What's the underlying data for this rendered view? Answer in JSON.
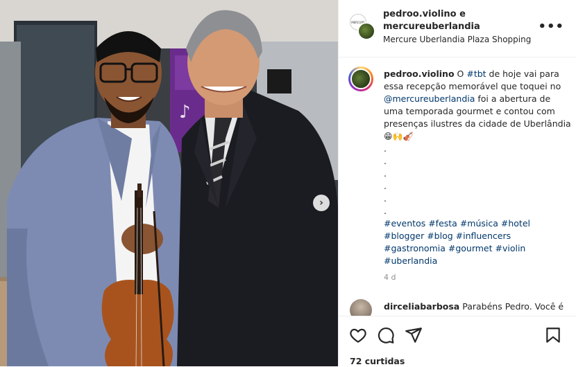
{
  "header": {
    "user1": "pedroo.violino",
    "connector": " e",
    "user2": "mercureuberlandia",
    "location": "Mercure Uberlandia Plaza Shopping",
    "avatar_badge": "MERCURE"
  },
  "caption": {
    "username": "pedroo.violino",
    "part1": "O ",
    "tag_tbt": "#tbt",
    "part2": " de hoje vai para essa recepção memorável que toquei no ",
    "mention": "@mercureuberlandia",
    "part3": " foi a abertura de uma temporada gourmet e contou com presenças ilustres da cidade de Uberlândia ",
    "emojis": "😁🙌🎻",
    "dots": [
      ".",
      ".",
      ".",
      ".",
      ".",
      "."
    ],
    "hashtags_line1": "#eventos #festa #música #hotel",
    "hashtags_line2": "#blogger #blog #influencers",
    "hashtags_line3": "#gastronomia #gourmet #violin",
    "hashtags_line4": "#uberlandia",
    "time": "4 d"
  },
  "comment": {
    "username": "dirceliabarbosa",
    "text": " Parabéns Pedro. Você é"
  },
  "actions": {
    "likes": "72 curtidas",
    "icons": [
      "heart-icon",
      "comment-icon",
      "share-icon",
      "bookmark-icon"
    ]
  },
  "carousel": {
    "next_symbol": "›"
  },
  "colors": {
    "link": "#00376b",
    "muted": "#8e8e8e",
    "text": "#262626",
    "purple_wall": "#6a2c8c"
  }
}
